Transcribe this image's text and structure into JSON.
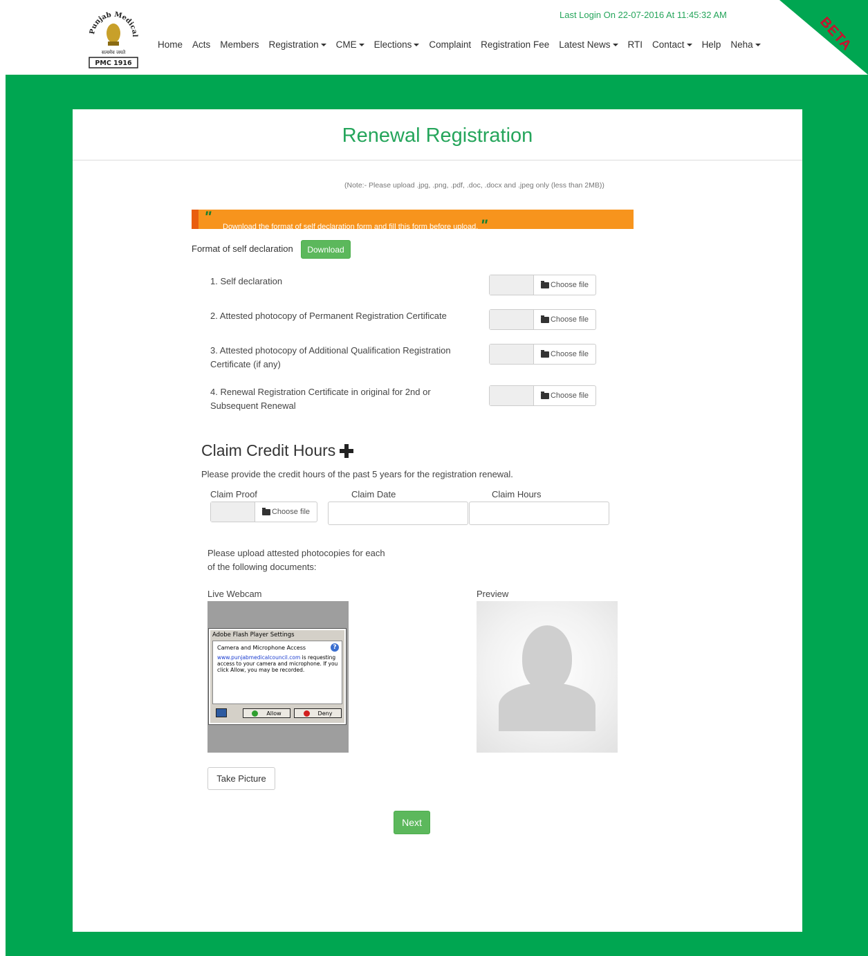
{
  "header": {
    "logo_text": "Punjab Medical Council",
    "logo_motto": "सत्यमेव जयते",
    "logo_year": "PMC 1916",
    "last_login": "Last Login On 22-07-2016 At 11:45:32 AM",
    "beta": "BETA",
    "nav": [
      {
        "label": "Home",
        "dropdown": false
      },
      {
        "label": "Acts",
        "dropdown": false
      },
      {
        "label": "Members",
        "dropdown": false
      },
      {
        "label": "Registration",
        "dropdown": true
      },
      {
        "label": "CME",
        "dropdown": true
      },
      {
        "label": "Elections",
        "dropdown": true
      },
      {
        "label": "Complaint",
        "dropdown": false
      },
      {
        "label": "Registration Fee",
        "dropdown": false
      },
      {
        "label": "Latest News",
        "dropdown": true
      },
      {
        "label": "RTI",
        "dropdown": false
      },
      {
        "label": "Contact",
        "dropdown": true
      },
      {
        "label": "Help",
        "dropdown": false
      },
      {
        "label": "Neha",
        "dropdown": true
      }
    ]
  },
  "form": {
    "title": "Renewal Registration",
    "note": "(Note:- Please upload .jpg, .png, .pdf, .doc, .docx and .jpeg only (less than 2MB))",
    "banner_text": "Download the format of self declaration form and fill this form before upload.",
    "format_label": "Format of self declaration",
    "download_label": "Download",
    "choose_file_label": "Choose file",
    "documents": [
      {
        "label": "1. Self declaration"
      },
      {
        "label": "2. Attested photocopy of Permanent Registration Certificate"
      },
      {
        "label": "3. Attested photocopy of Additional Qualification Registration Certificate (if any)"
      },
      {
        "label": "4. Renewal Registration Certificate in original for 2nd or Subsequent Renewal"
      }
    ]
  },
  "claim": {
    "heading": "Claim Credit Hours",
    "description": "Please provide the credit hours of the past 5 years for the registration renewal.",
    "col_proof": "Claim Proof",
    "col_date": "Claim Date",
    "col_hours": "Claim Hours",
    "date_value": "",
    "hours_value": ""
  },
  "photo": {
    "upload_note": "Please upload attested photocopies for each of the following documents:",
    "webcam_label": "Live Webcam",
    "preview_label": "Preview",
    "flash_title": "Adobe Flash Player Settings",
    "flash_heading": "Camera and Microphone Access",
    "flash_link": "www.punjabmedicalcouncil.com",
    "flash_msg": " is requesting access to your camera and microphone. If you click Allow, you may be recorded.",
    "allow_label": "Allow",
    "deny_label": "Deny",
    "take_picture_label": "Take Picture"
  },
  "actions": {
    "next_label": "Next"
  },
  "colors": {
    "brand_green": "#00a651",
    "title_green": "#25a55b",
    "banner_orange": "#f7941d",
    "button_green": "#5cb85c",
    "beta_red": "#c8102e"
  }
}
